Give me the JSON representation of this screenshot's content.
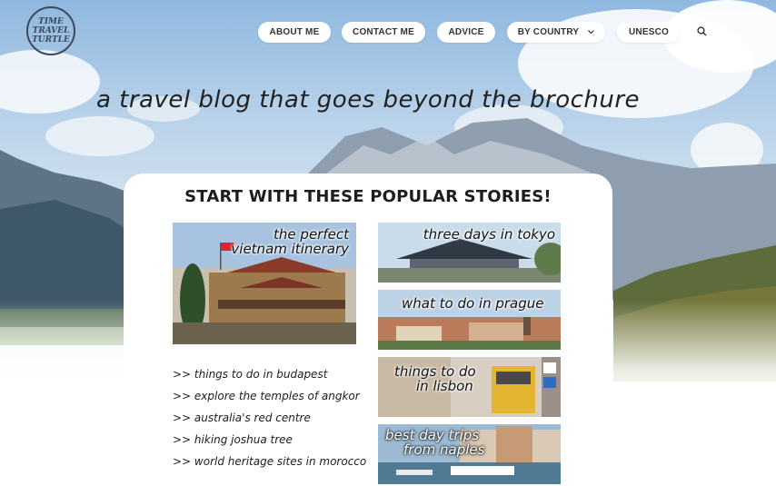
{
  "logo": {
    "line1": "TIME",
    "line2": "TRAVEL",
    "line3": "TURTLE"
  },
  "nav": {
    "items": [
      {
        "label": "ABOUT ME"
      },
      {
        "label": "CONTACT ME"
      },
      {
        "label": "ADVICE"
      },
      {
        "label": "BY COUNTRY",
        "chevron": "chevron-down-icon"
      },
      {
        "label": "UNESCO"
      }
    ],
    "search_icon": "search-icon"
  },
  "tagline": "a travel blog that goes beyond the brochure",
  "section_title": "START WITH THESE POPULAR STORIES!",
  "stories": {
    "vietnam": {
      "line1": "the perfect",
      "line2": "vietnam itinerary"
    },
    "tokyo": {
      "label": "three days in tokyo"
    },
    "prague": {
      "label": "what to do in prague"
    },
    "lisbon": {
      "line1": "things to do",
      "line2": "in lisbon"
    },
    "naples": {
      "line1": "best day trips",
      "line2": "from naples"
    }
  },
  "links": [
    ">> things to do in budapest",
    ">> explore the temples of angkor",
    ">> australia's red centre",
    ">> hiking joshua tree",
    ">> world heritage sites in morocco"
  ],
  "colors": {
    "text": "#1d1d1d",
    "nav_bg": "#ffffff",
    "sky": "#8fb8df"
  }
}
